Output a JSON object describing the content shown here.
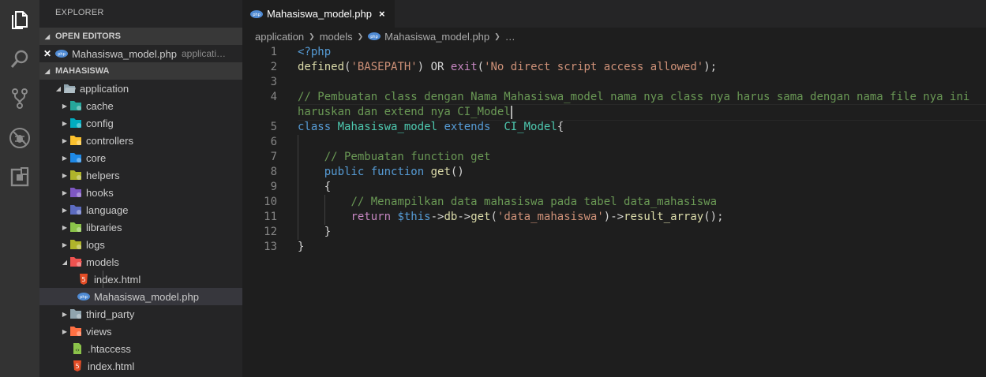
{
  "activity_bar": {
    "icons": [
      "files-icon",
      "search-icon",
      "source-control-icon",
      "debug-icon",
      "extensions-icon"
    ]
  },
  "sidebar": {
    "title": "EXPLORER",
    "open_editors": {
      "header": "OPEN EDITORS",
      "items": [
        {
          "name": "Mahasiswa_model.php",
          "desc": "applicati…"
        }
      ]
    },
    "workspace": {
      "header": "MAHASISWA",
      "root": "application",
      "folders": [
        {
          "name": "cache",
          "color": "#26a69a"
        },
        {
          "name": "config",
          "color": "#00acc1"
        },
        {
          "name": "controllers",
          "color": "#fbc02d"
        },
        {
          "name": "core",
          "color": "#1e88e5"
        },
        {
          "name": "helpers",
          "color": "#afb42b"
        },
        {
          "name": "hooks",
          "color": "#7e57c2"
        },
        {
          "name": "language",
          "color": "#5c6bc0"
        },
        {
          "name": "libraries",
          "color": "#8bc34a"
        },
        {
          "name": "logs",
          "color": "#afb42b"
        },
        {
          "name": "models",
          "color": "#ef5350"
        }
      ],
      "model_files": [
        "index.html",
        "Mahasiswa_model.php"
      ],
      "folders_after": [
        {
          "name": "third_party",
          "color": "#90a4ae"
        },
        {
          "name": "views",
          "color": "#ff7043"
        }
      ],
      "root_files": [
        ".htaccess",
        "index.html"
      ]
    }
  },
  "editor": {
    "tab": {
      "label": "Mahasiswa_model.php",
      "close": "×"
    },
    "breadcrumbs": [
      "application",
      "models",
      "Mahasiswa_model.php",
      "…"
    ],
    "line_numbers": [
      "1",
      "2",
      "3",
      "4",
      "",
      "5",
      "6",
      "7",
      "8",
      "9",
      "10",
      "11",
      "12",
      "13"
    ],
    "lines": [
      "<?php",
      "defined('BASEPATH') OR exit('No direct script access allowed');",
      "",
      "// Pembuatan class dengan Nama Mahasiswa_model nama nya class nya harus sama dengan nama file nya ini",
      "haruskan dan extend nya CI_Model",
      "class Mahasiswa_model extends  CI_Model{",
      "",
      "    // Pembuatan function get",
      "    public function get()",
      "    {",
      "        // Menampilkan data mahasiswa pada tabel data_mahasiswa",
      "        return $this->db->get('data_mahasiswa')->result_array();",
      "    }",
      "}"
    ]
  }
}
